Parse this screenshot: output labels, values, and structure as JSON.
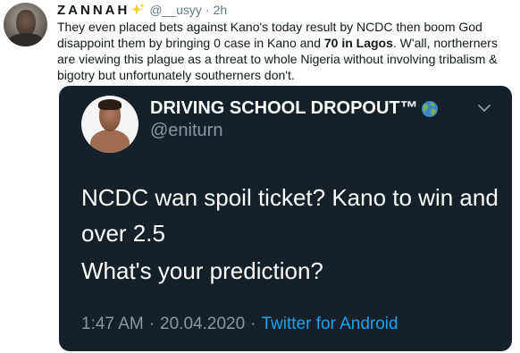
{
  "tweet": {
    "display_name": "ZANNAH",
    "handle": "@__usyy",
    "dot": "·",
    "time": "2h",
    "text_before": "They even placed bets against Kano's today result by NCDC then boom God disappoint them by bringing 0 case in Kano and ",
    "text_bold": "70 in Lagos",
    "text_after": ". W'all, northerners are viewing this plague as a threat to whole Nigeria without involving tribalism & bigotry but unfortunately southerners don't."
  },
  "quoted": {
    "name": "DRIVING SCHOOL DROPOUT™",
    "handle": "@eniturn",
    "text_line1": "NCDC wan spoil ticket? Kano to win and over 2.5",
    "text_line2": "What's your prediction?",
    "time": "1:47 AM",
    "dot1": "·",
    "date": "20.04.2020",
    "dot2": "·",
    "source": "Twitter for Android"
  },
  "colors": {
    "quote_background": "#15202b",
    "link_blue": "#1da1f2",
    "secondary_text": "#657786"
  },
  "icons": [
    "sparkle-icon",
    "globe-icon",
    "chevron-down-icon"
  ]
}
